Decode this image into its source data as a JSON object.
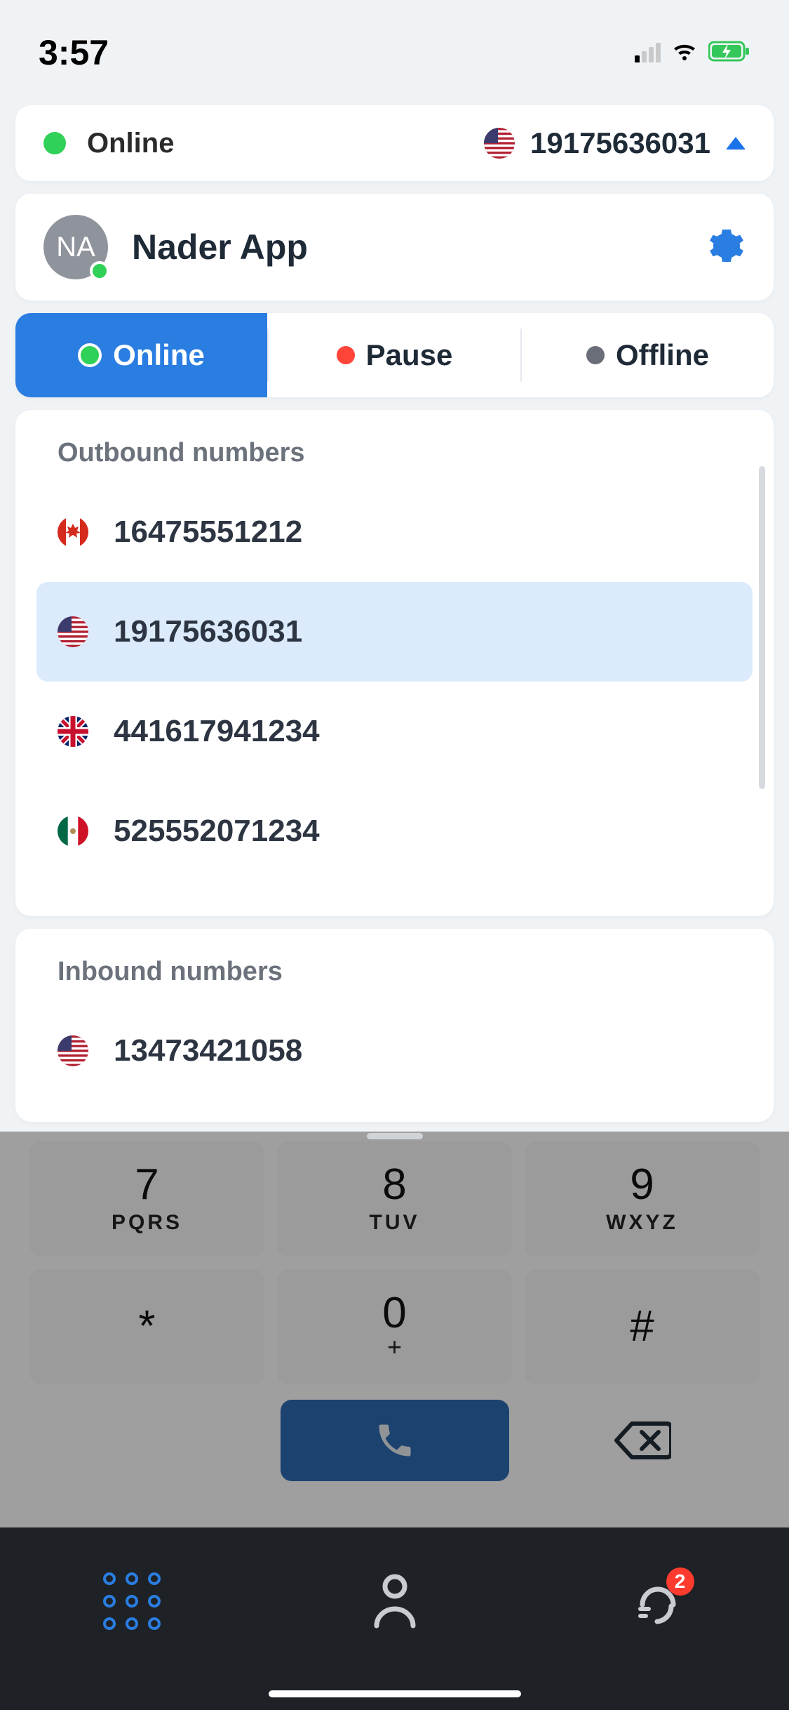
{
  "status_bar": {
    "time": "3:57"
  },
  "header": {
    "status_label": "Online",
    "selected_number": "19175636031",
    "selected_flag": "us"
  },
  "profile": {
    "initials": "NA",
    "name": "Nader App"
  },
  "status_tabs": {
    "online": "Online",
    "pause": "Pause",
    "offline": "Offline",
    "active": "online"
  },
  "outbound": {
    "title": "Outbound numbers",
    "items": [
      {
        "flag": "ca",
        "number": "16475551212",
        "selected": false
      },
      {
        "flag": "us",
        "number": "19175636031",
        "selected": true
      },
      {
        "flag": "gb",
        "number": "441617941234",
        "selected": false
      },
      {
        "flag": "mx",
        "number": "525552071234",
        "selected": false
      }
    ]
  },
  "inbound": {
    "title": "Inbound numbers",
    "items": [
      {
        "flag": "us",
        "number": "13473421058",
        "selected": false
      }
    ]
  },
  "keypad": {
    "row1": [
      {
        "digit": "7",
        "letters": "PQRS"
      },
      {
        "digit": "8",
        "letters": "TUV"
      },
      {
        "digit": "9",
        "letters": "WXYZ"
      }
    ],
    "row2": [
      {
        "digit": "*",
        "letters": ""
      },
      {
        "digit": "0",
        "letters": "+"
      },
      {
        "digit": "#",
        "letters": ""
      }
    ]
  },
  "nav": {
    "badge": "2"
  }
}
